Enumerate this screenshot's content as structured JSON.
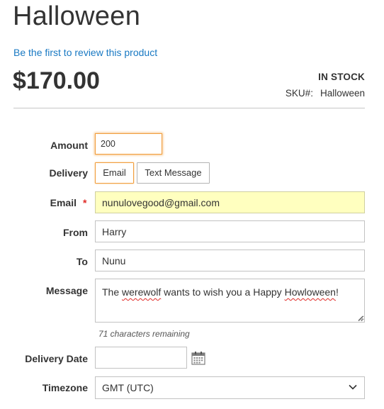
{
  "product": {
    "name": "Halloween",
    "review_link": "Be the first to review this product",
    "price": "$170.00",
    "stock_status": "IN STOCK",
    "sku_label": "SKU#:",
    "sku_value": "Halloween"
  },
  "form": {
    "amount": {
      "label": "Amount",
      "value": "200"
    },
    "delivery": {
      "label": "Delivery",
      "options": [
        "Email",
        "Text Message"
      ],
      "selected": "Email"
    },
    "email": {
      "label": "Email",
      "required_mark": "*",
      "value": "nunulovegood@gmail.com"
    },
    "from": {
      "label": "From",
      "value": "Harry"
    },
    "to": {
      "label": "To",
      "value": "Nunu"
    },
    "message": {
      "label": "Message",
      "part1": "The ",
      "part2": "werewolf",
      "part3": " wants to wish you a Happy ",
      "part4": "Howloween",
      "part5": "!",
      "remaining": "71 characters remaining"
    },
    "delivery_date": {
      "label": "Delivery Date",
      "value": ""
    },
    "timezone": {
      "label": "Timezone",
      "value": "GMT (UTC)"
    }
  },
  "icons": {
    "calendar": "calendar-icon",
    "dropdown": "chevron-down-icon"
  },
  "colors": {
    "link": "#1979c3",
    "focus": "#f19e3d",
    "autofill": "#ffffbf",
    "required": "#e02b27"
  }
}
